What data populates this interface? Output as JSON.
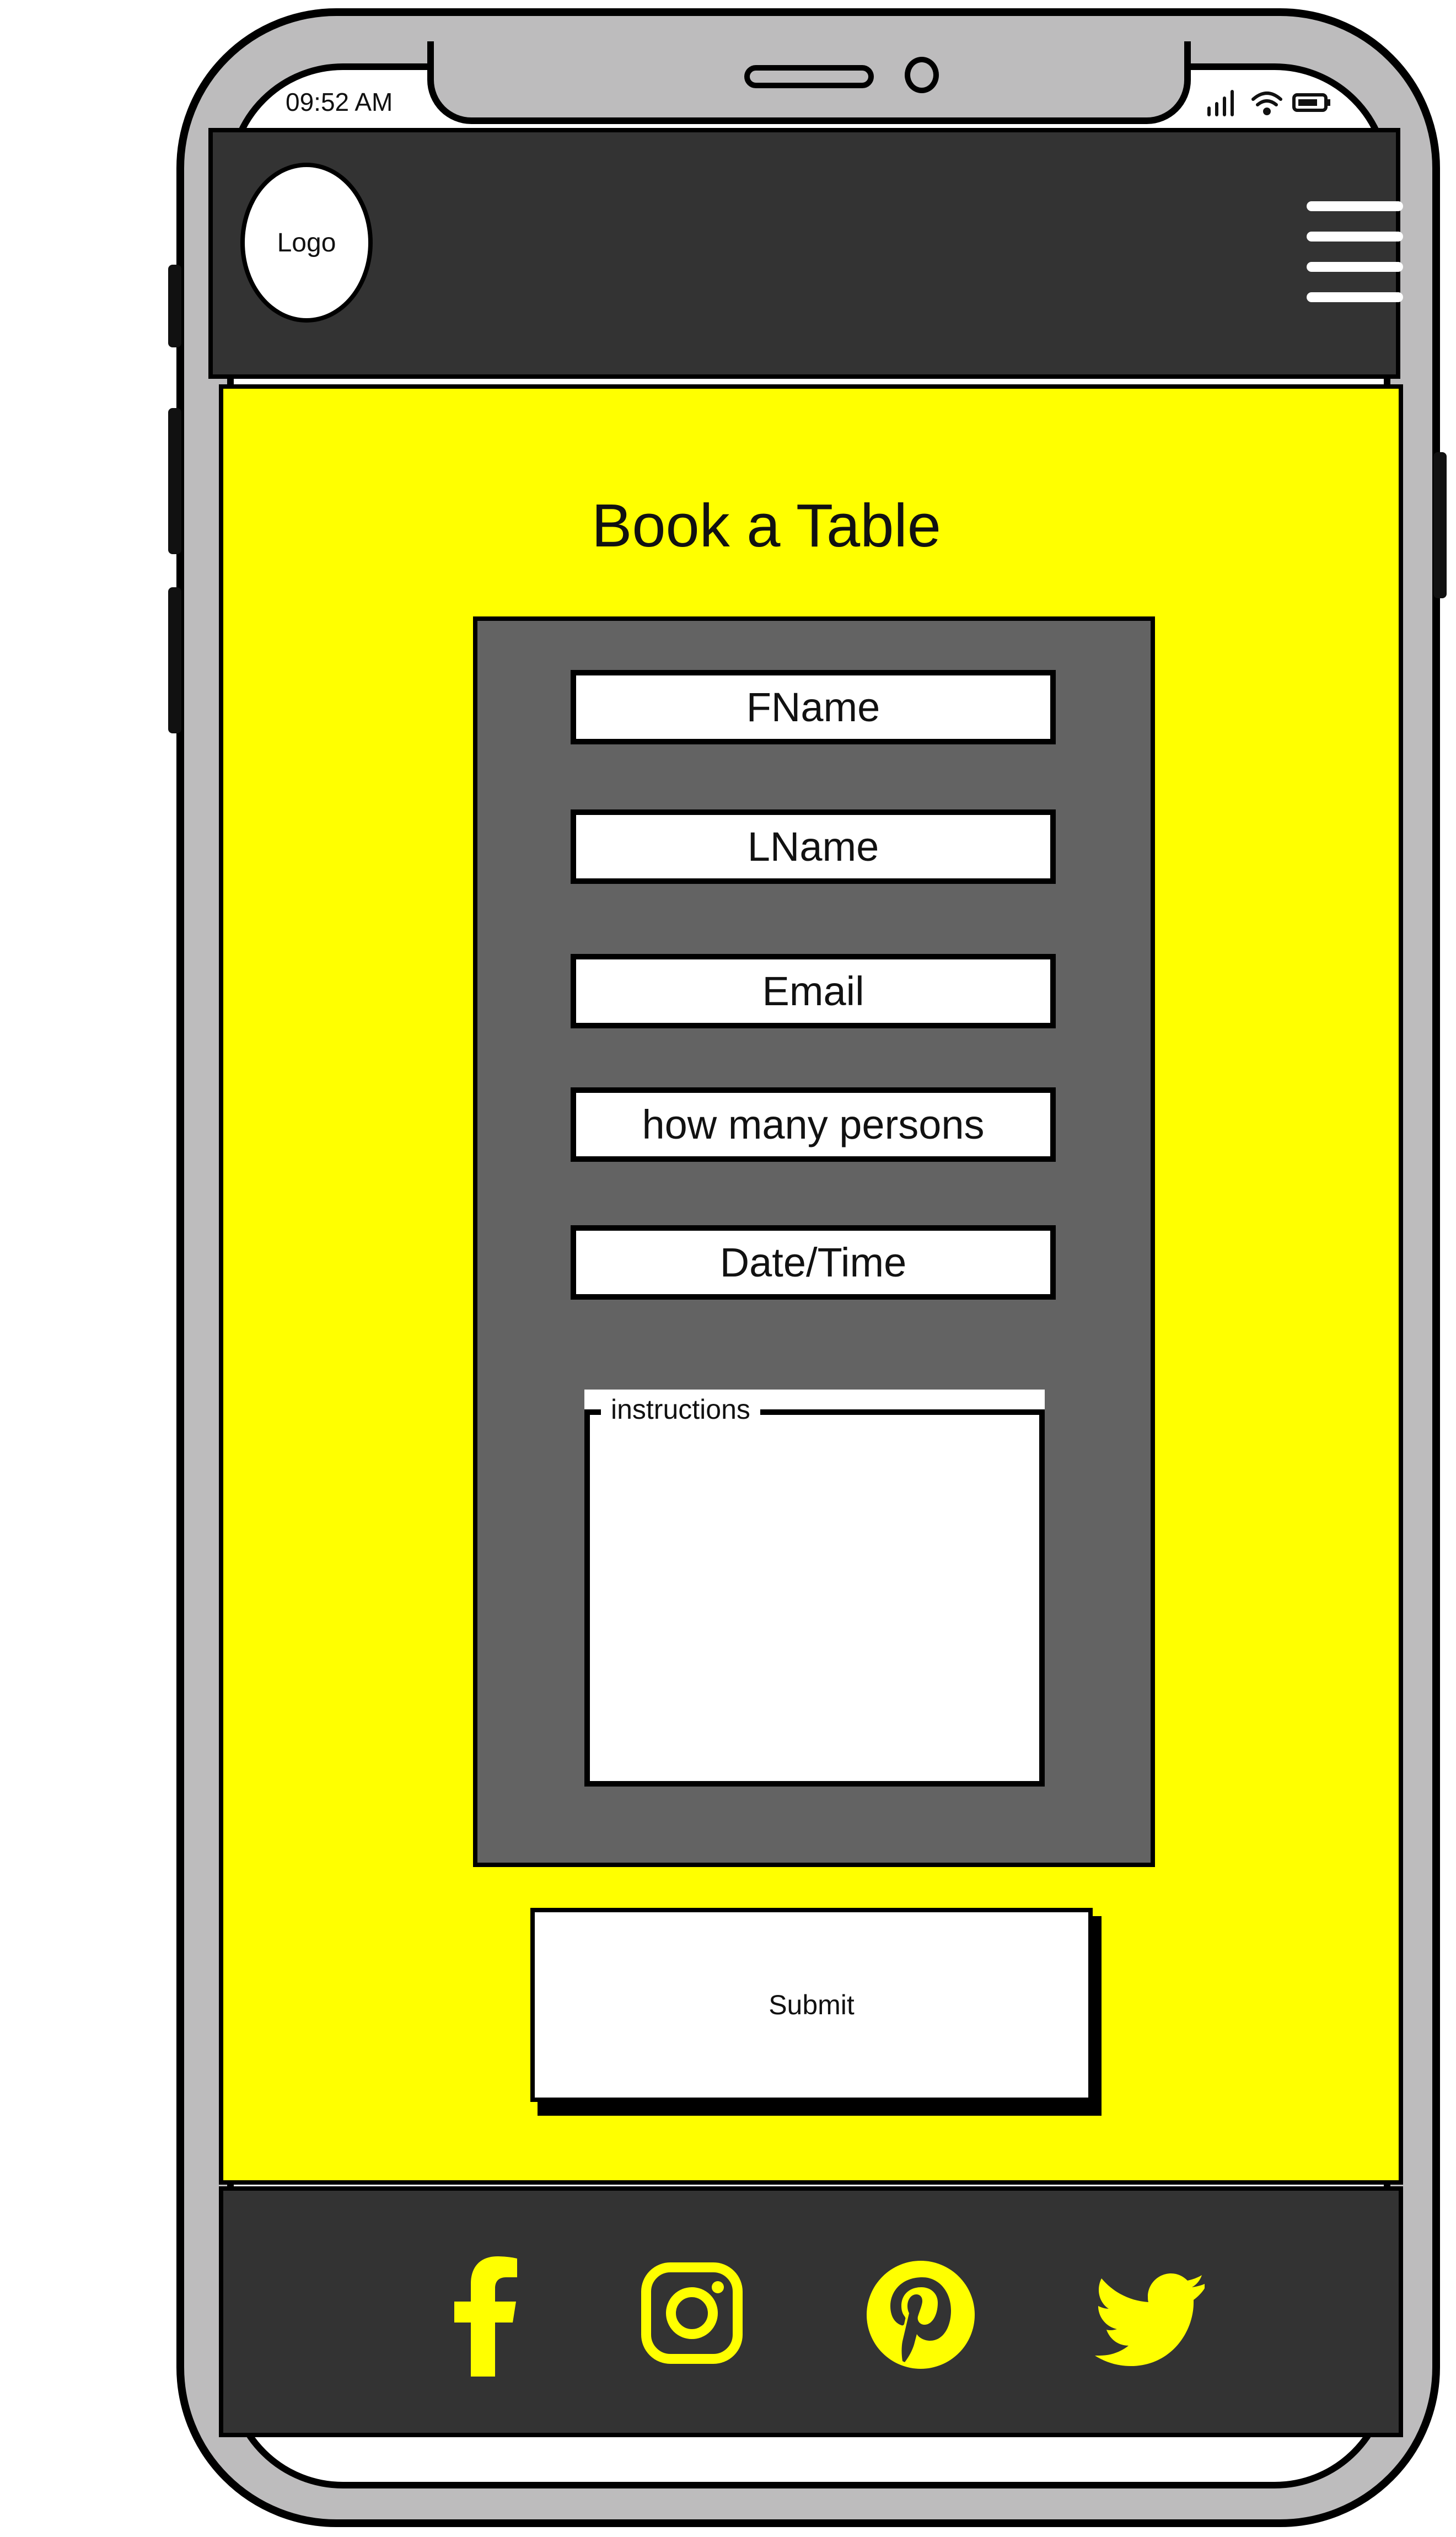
{
  "status_bar": {
    "time": "09:52 AM"
  },
  "header": {
    "logo_text": "Logo"
  },
  "main": {
    "title": "Book a Table",
    "form": {
      "fname_placeholder": "FName",
      "lname_placeholder": "LName",
      "email_placeholder": "Email",
      "persons_placeholder": "how many persons",
      "datetime_placeholder": "Date/Time",
      "instructions_label": "instructions"
    },
    "submit_label": "Submit"
  },
  "footer": {
    "social": [
      "facebook-icon",
      "instagram-icon",
      "pinterest-icon",
      "twitter-icon"
    ]
  },
  "colors": {
    "accent": "#ffff00",
    "header_bg": "#333333",
    "panel_bg": "#636363",
    "shell": "#bdbcbd"
  }
}
